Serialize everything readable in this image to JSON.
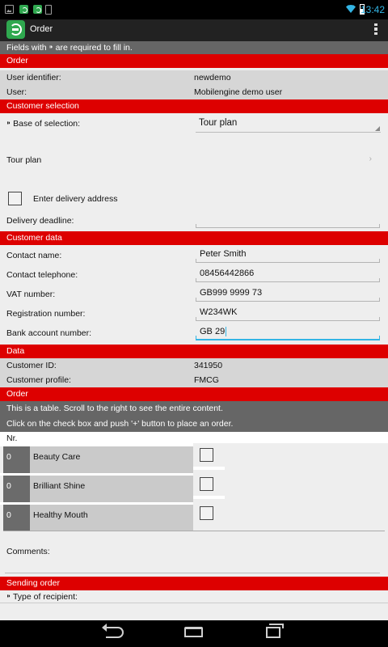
{
  "status_bar": {
    "time": "13:42",
    "icons": [
      "image-icon",
      "app-notification-icon",
      "app-notification-icon",
      "phone-icon",
      "wifi-icon",
      "battery-icon"
    ]
  },
  "action_bar": {
    "title": "Order",
    "logo_icon": "mobilengine-logo-icon",
    "menu_icon": "overflow-menu-icon"
  },
  "form": {
    "required_note": "Fields with ⁍ are required to fill in.",
    "order_section": {
      "title": "Order",
      "user_identifier_label": "User identifier:",
      "user_identifier_value": "newdemo",
      "user_label": "User:",
      "user_value": "Mobilengine demo user"
    },
    "customer_selection": {
      "title": "Customer selection",
      "base_label": "⁍ Base of selection:",
      "base_value": "Tour plan",
      "tour_plan_label": "Tour plan",
      "chevron": "›",
      "delivery_address_label": "Enter delivery address",
      "delivery_address_checked": false,
      "delivery_deadline_label": "Delivery deadline:",
      "delivery_deadline_value": ""
    },
    "customer_data": {
      "title": "Customer data",
      "contact_name_label": "Contact name:",
      "contact_name_value": "Peter Smith",
      "contact_phone_label": "Contact telephone:",
      "contact_phone_value": "08456442866",
      "vat_label": "VAT number:",
      "vat_value": "GB999 9999 73",
      "registration_label": "Registration number:",
      "registration_value": "W234WK",
      "bank_label": "Bank account number:",
      "bank_value": "GB 29"
    },
    "data_section": {
      "title": "Data",
      "customer_id_label": "Customer ID:",
      "customer_id_value": "341950",
      "customer_profile_label": "Customer profile:",
      "customer_profile_value": "FMCG"
    },
    "order_table": {
      "title": "Order",
      "hint_line1": "This is a table. Scroll to the right to see the entire content.",
      "hint_line2": "Click on the check box and push  '+' button to place an order.",
      "column_nr": "Nr.",
      "rows": [
        {
          "qty": "0",
          "name": "Beauty Care",
          "checked": false
        },
        {
          "qty": "0",
          "name": "Brilliant Shine",
          "checked": false
        },
        {
          "qty": "0",
          "name": "Healthy Mouth",
          "checked": false
        }
      ]
    },
    "comments": {
      "label": "Comments:",
      "value": ""
    },
    "sending_order": {
      "title": "Sending order",
      "recipient_label": "⁍ Type of recipient:"
    }
  },
  "nav_bar": {
    "icons": [
      "back-icon",
      "home-icon",
      "recent-apps-icon"
    ]
  }
}
